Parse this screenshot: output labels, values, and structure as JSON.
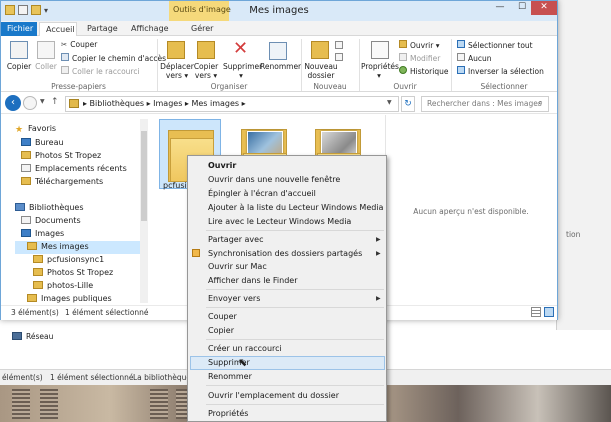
{
  "window": {
    "title": "Mes images",
    "contextual_group": "Outils d'image",
    "controls": {
      "minimize": "—",
      "maximize": "☐",
      "close": "✕"
    }
  },
  "ribbon_tabs": [
    "Fichier",
    "Accueil",
    "Partage",
    "Affichage",
    "Gérer"
  ],
  "ribbon": {
    "presse_papiers": {
      "label": "Presse-papiers",
      "copier": "Copier",
      "coller": "Coller",
      "couper": "Couper",
      "copier_chemin": "Copier le chemin d'accès",
      "coller_raccourci": "Coller le raccourci"
    },
    "organiser": {
      "label": "Organiser",
      "deplacer": [
        "Déplacer",
        "vers ▾"
      ],
      "copier_vers": [
        "Copier",
        "vers ▾"
      ],
      "supprimer": "Supprimer ▾",
      "renommer": "Renommer"
    },
    "nouveau": {
      "label": "Nouveau",
      "nouveau_dossier": [
        "Nouveau",
        "dossier"
      ]
    },
    "ouvrir": {
      "label": "Ouvrir",
      "proprietes": [
        "Propriétés",
        "▾"
      ],
      "ouvrir": "Ouvrir ▾",
      "modifier": "Modifier",
      "historique": "Historique"
    },
    "selectionner": {
      "label": "Sélectionner",
      "tout": "Sélectionner tout",
      "aucun": "Aucun",
      "inverser": "Inverser la sélection"
    }
  },
  "address": {
    "path": "▸  Bibliothèques  ▸  Images  ▸  Mes images  ▸",
    "search_placeholder": "Rechercher dans : Mes images"
  },
  "nav_pane": {
    "items": [
      {
        "label": "Favoris",
        "icon": "star-icon"
      },
      {
        "label": "Bureau",
        "icon": "desktop-icon"
      },
      {
        "label": "Photos St Tropez",
        "icon": "folder-icon"
      },
      {
        "label": "Emplacements récents",
        "icon": "recent-icon"
      },
      {
        "label": "Téléchargements",
        "icon": "download-icon"
      },
      {
        "label": "Bibliothèques",
        "icon": "library-icon"
      },
      {
        "label": "Documents",
        "icon": "documents-icon"
      },
      {
        "label": "Images",
        "icon": "images-icon"
      },
      {
        "label": "Mes images",
        "icon": "folder-icon"
      },
      {
        "label": "pcfusionsync1",
        "icon": "folder-icon"
      },
      {
        "label": "Photos St Tropez",
        "icon": "folder-icon"
      },
      {
        "label": "photos-Lille",
        "icon": "folder-icon"
      },
      {
        "label": "Images publiques",
        "icon": "folder-icon"
      }
    ]
  },
  "content": {
    "items": [
      {
        "label": "pcfusi"
      }
    ]
  },
  "preview": {
    "text": "Aucun aperçu n'est disponible."
  },
  "status": {
    "count": "3 élément(s)",
    "selected": "1 élément sélectionné"
  },
  "context_menu": {
    "items": [
      "Ouvrir",
      "Ouvrir dans une nouvelle fenêtre",
      "Épingler à l'écran d'accueil",
      "Ajouter à la liste du Lecteur Windows Media",
      "Lire avec le Lecteur Windows Media",
      "Partager avec",
      "Synchronisation des dossiers partagés",
      "Ouvrir sur Mac",
      "Afficher dans le Finder",
      "Envoyer vers",
      "Couper",
      "Copier",
      "Créer un raccourci",
      "Supprimer",
      "Renommer",
      "Ouvrir l'emplacement du dossier",
      "Propriétés"
    ]
  },
  "background": {
    "reseau": "Réseau",
    "status_count": "élément(s)",
    "status_selected": "1 élément sélectionné",
    "status_path": "La bibliothèque",
    "right_text": "tion"
  },
  "colors": {
    "accent": "#1979ca",
    "folder": "#e6bd4f",
    "selection": "#cce8ff",
    "close_button": "#c75050"
  }
}
